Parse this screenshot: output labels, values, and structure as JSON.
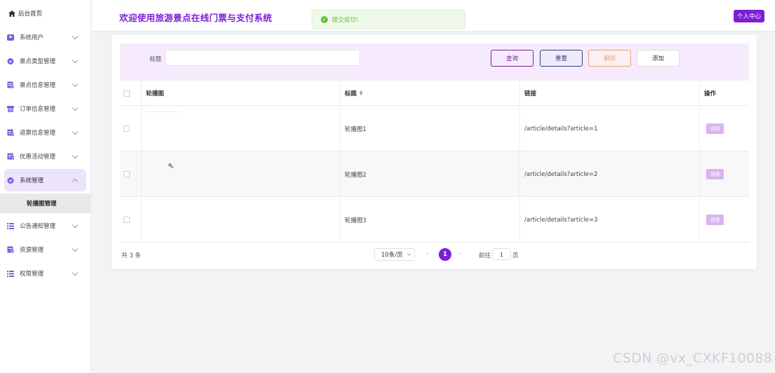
{
  "sidebar": {
    "home_label": "后台首页",
    "items": [
      {
        "label": "系统用户",
        "icon": "user-icon",
        "color": "#7b5fd9"
      },
      {
        "label": "景点类型管理",
        "icon": "tag-icon",
        "color": "#7b5fd9"
      },
      {
        "label": "景点信息管理",
        "icon": "document-icon",
        "color": "#7b5fd9"
      },
      {
        "label": "订单信息管理",
        "icon": "order-icon",
        "color": "#7b5fd9"
      },
      {
        "label": "退票信息管理",
        "icon": "refund-icon",
        "color": "#7b5fd9"
      },
      {
        "label": "优惠活动管理",
        "icon": "discount-icon",
        "color": "#7b5fd9"
      },
      {
        "label": "系统管理",
        "icon": "settings-icon",
        "color": "#7b5fd9",
        "open": true
      },
      {
        "label": "公告通知管理",
        "icon": "list-icon",
        "color": "#7b5fd9"
      },
      {
        "label": "资源管理",
        "icon": "resource-icon",
        "color": "#7b5fd9"
      },
      {
        "label": "权限管理",
        "icon": "permission-icon",
        "color": "#7b5fd9"
      }
    ],
    "sub_item": "轮播图管理"
  },
  "header": {
    "title": "欢迎使用旅游景点在线门票与支付系统",
    "profile_label": "个人中心"
  },
  "toast": {
    "message": "提交成功!",
    "icon": "check-circle-icon"
  },
  "filter": {
    "title_label": "标题",
    "title_value": "",
    "query_label": "查询",
    "reset_label": "重置",
    "delete_label": "删除",
    "add_label": "添加"
  },
  "table": {
    "columns": [
      "轮播图",
      "标题",
      "链接",
      "操作"
    ],
    "rows": [
      {
        "title": "轮播图1",
        "link": "/article/details?article=1",
        "action": "详情"
      },
      {
        "title": "轮播图2",
        "link": "/article/details?article=2",
        "action": "详情"
      },
      {
        "title": "轮播图3",
        "link": "/article/details?article=3",
        "action": "详情"
      }
    ]
  },
  "pagination": {
    "total": "共 3 条",
    "page_size": "10条/页",
    "current_page": "1",
    "goto_label": "前往",
    "goto_value": "1",
    "goto_suffix": "页"
  },
  "watermark": "CSDN @vx_CXKF10088",
  "colors": {
    "accent": "#7b1fd6",
    "filter_bg": "#f6ebfc",
    "success": "#67c23a"
  }
}
